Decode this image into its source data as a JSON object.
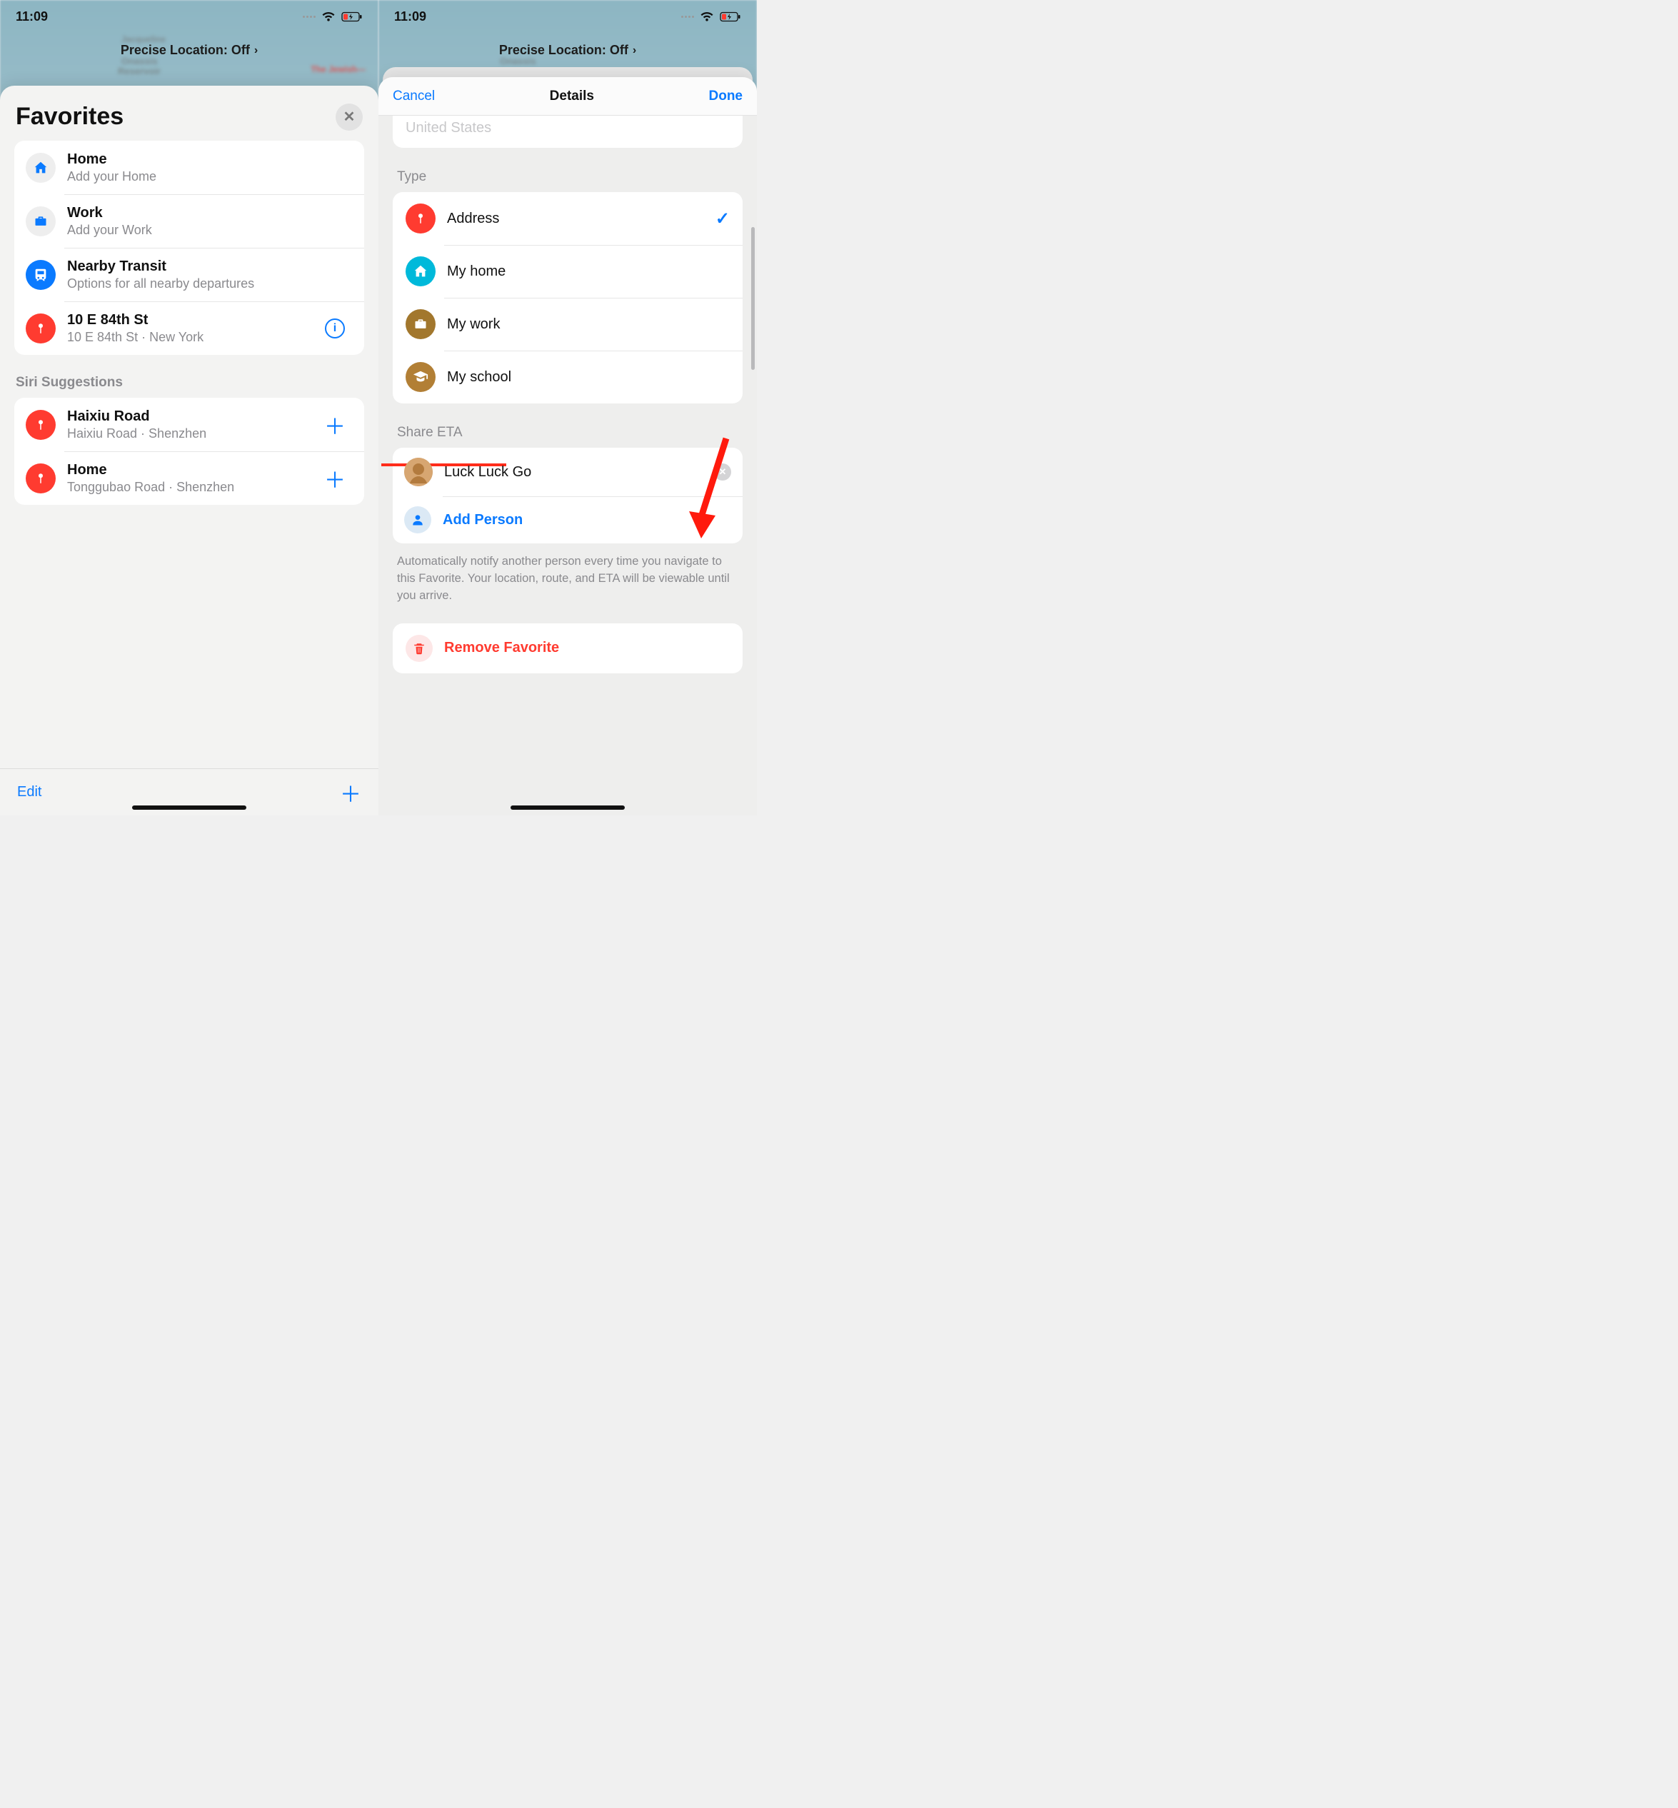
{
  "status": {
    "time": "11:09"
  },
  "map": {
    "precise_location_label": "Precise Location: Off",
    "jewish_label": "The Jewish—",
    "onassis": "Onassis",
    "reservoir": "Reservoir",
    "jacqueline": "Jacqueline"
  },
  "left": {
    "title": "Favorites",
    "items": [
      {
        "title": "Home",
        "sub": "Add your Home",
        "icon": "home",
        "action": null
      },
      {
        "title": "Work",
        "sub": "Add your Work",
        "icon": "briefcase",
        "action": null
      },
      {
        "title": "Nearby Transit",
        "sub": "Options for all nearby departures",
        "icon": "transit",
        "action": null
      },
      {
        "title": "10 E 84th St",
        "sub": "10 E 84th St · New York",
        "icon": "pin",
        "action": "info"
      }
    ],
    "siri_header": "Siri Suggestions",
    "suggestions": [
      {
        "title": "Haixiu Road",
        "sub": "Haixiu Road · Shenzhen",
        "icon": "pin"
      },
      {
        "title": "Home",
        "sub": "Tonggubao Road · Shenzhen",
        "icon": "pin"
      }
    ],
    "edit_label": "Edit"
  },
  "right": {
    "cancel": "Cancel",
    "title": "Details",
    "done": "Done",
    "clipped_text": "United States",
    "type_header": "Type",
    "types": [
      {
        "label": "Address",
        "icon": "pin",
        "color": "ic-red",
        "checked": true
      },
      {
        "label": "My home",
        "icon": "home",
        "color": "ic-cyan",
        "checked": false
      },
      {
        "label": "My work",
        "icon": "briefcase",
        "color": "ic-brown",
        "checked": false
      },
      {
        "label": "My school",
        "icon": "grad",
        "color": "ic-brown2",
        "checked": false
      }
    ],
    "share_header": "Share ETA",
    "contact_name": "Luck Luck Go",
    "add_person": "Add Person",
    "footer_note": "Automatically notify another person every time you navigate to this Favorite. Your location, route, and ETA will be viewable until you arrive.",
    "remove_label": "Remove Favorite"
  }
}
